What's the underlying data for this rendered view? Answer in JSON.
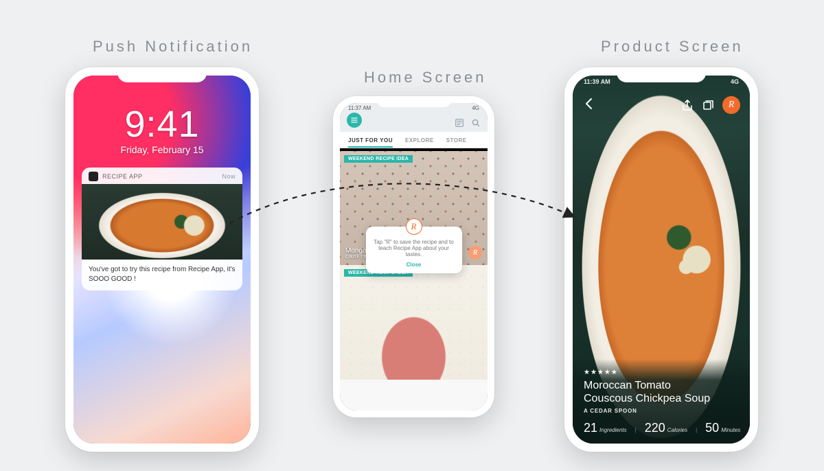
{
  "headings": {
    "push": "Push Notification",
    "home": "Home Screen",
    "product": "Product Screen"
  },
  "push": {
    "time": "9:41",
    "date": "Friday, February 15",
    "notif": {
      "app": "RECIPE APP",
      "when": "Now",
      "body": "You've got to try this recipe from Recipe App, it's SOOO GOOD !"
    }
  },
  "home": {
    "status_time": "11:37 AM",
    "status_net": "4G",
    "tabs": {
      "t1": "JUST FOR YOU",
      "t2": "EXPLORE",
      "t3": "STORE"
    },
    "card1": {
      "tag": "WEEKEND RECIPE IDEA",
      "title": "Mongolian Chicken",
      "author": "CRAFTY CREATIVE KATHY"
    },
    "card2": {
      "tag": "WEEKEND RECIPE IDEA"
    },
    "tooltip": {
      "text": "Tap \"R\" to save the recipe and to teach Recipe App about your tastes.",
      "close": "Close"
    },
    "r": "R"
  },
  "product": {
    "status_time": "11:39 AM",
    "status_net": "4G",
    "title_l1": "Moroccan Tomato",
    "title_l2": "Couscous Chickpea Soup",
    "author": "A CEDAR SPOON",
    "stars": "★★★★★",
    "meta": {
      "ingredients_n": "21",
      "ingredients_l": "Ingredients",
      "calories_n": "220",
      "calories_l": "Calories",
      "minutes_n": "50",
      "minutes_l": "Minutes"
    },
    "r": "R"
  }
}
